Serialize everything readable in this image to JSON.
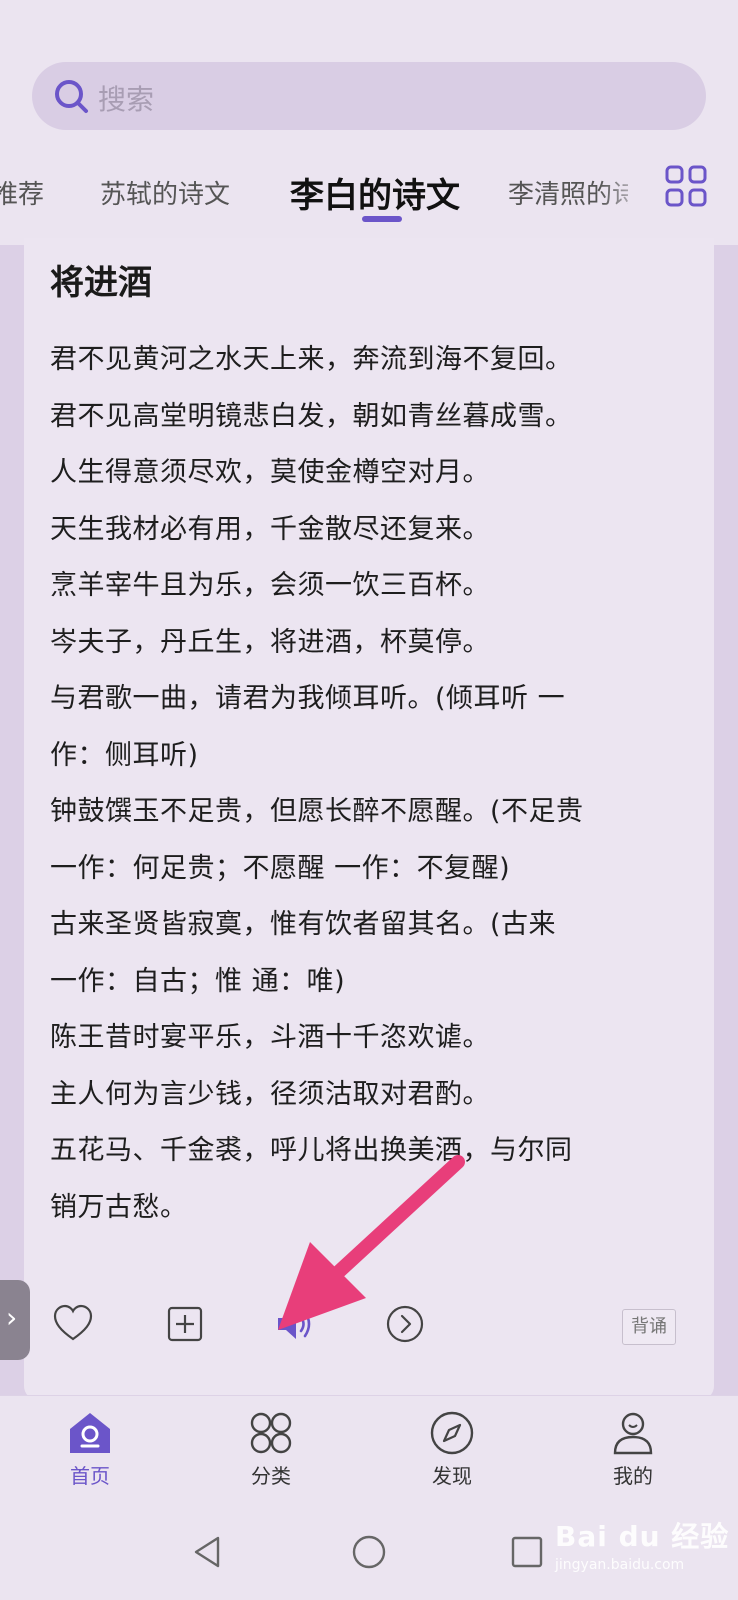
{
  "search": {
    "placeholder": "搜索",
    "icon": "search-icon"
  },
  "tabs": [
    {
      "label": "推荐"
    },
    {
      "label": "苏轼的诗文"
    },
    {
      "label": "李白的诗文",
      "active": true
    },
    {
      "label": "李清照的诗"
    }
  ],
  "poem": {
    "title": "将进酒",
    "lines": [
      "君不见黄河之水天上来，奔流到海不复回。",
      "君不见高堂明镜悲白发，朝如青丝暮成雪。",
      "人生得意须尽欢，莫使金樽空对月。",
      "天生我材必有用，千金散尽还复来。",
      "烹羊宰牛且为乐，会须一饮三百杯。",
      "岑夫子，丹丘生，将进酒，杯莫停。",
      "与君歌一曲，请君为我倾耳听。(倾耳听 一",
      "作：侧耳听)",
      "钟鼓馔玉不足贵，但愿长醉不愿醒。(不足贵",
      "一作：何足贵；不愿醒 一作：不复醒)",
      "古来圣贤皆寂寞，惟有饮者留其名。(古来",
      "一作：自古；惟 通：唯)",
      "陈王昔时宴平乐，斗酒十千恣欢谑。",
      "主人何为言少钱，径须沽取对君酌。",
      "五花马、千金裘，呼儿将出换美酒，与尔同",
      "销万古愁。"
    ]
  },
  "actions": {
    "recite_label": "背诵"
  },
  "side_tab": {
    "glyph": "›"
  },
  "nav": {
    "home": "首页",
    "category": "分类",
    "discover": "发现",
    "mine": "我的"
  },
  "watermark": {
    "brand": "Bai du 经验",
    "url": "jingyan.baidu.com"
  },
  "colors": {
    "accent": "#6b55c9",
    "arrow": "#e83e7a"
  }
}
